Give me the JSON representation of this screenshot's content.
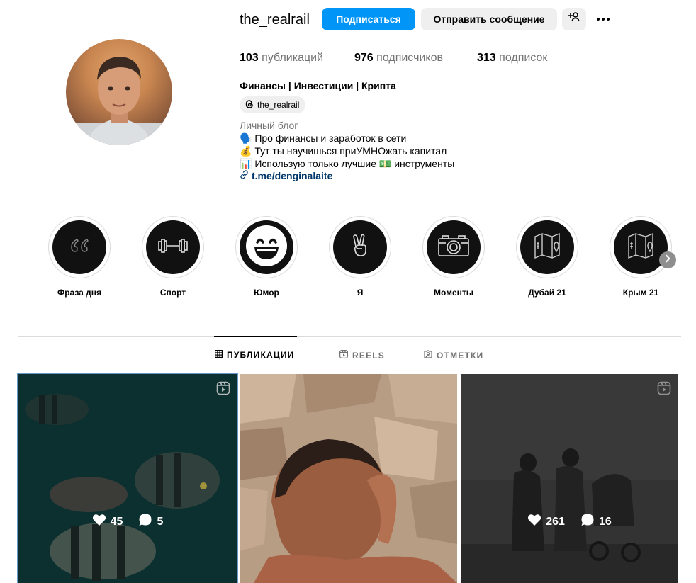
{
  "profile": {
    "username": "the_realrail",
    "follow_label": "Подписаться",
    "message_label": "Отправить сообщение",
    "stats": [
      {
        "value": "103",
        "label": "публикаций"
      },
      {
        "value": "976",
        "label": "подписчиков"
      },
      {
        "value": "313",
        "label": "подписок"
      }
    ],
    "bio_name": "Финансы | Инвестиции | Крипта",
    "threads_handle": "the_realrail",
    "category": "Личный блог",
    "bio_lines": [
      "🗣️ Про финансы и заработок в сети",
      "💰 Тут ты научишься приУМНОжать капитал",
      "📊 Использую только лучшие 💵 инструменты"
    ],
    "link": "t.me/denginalaite"
  },
  "highlights": [
    {
      "label": "Фраза дня",
      "icon": "quote-icon"
    },
    {
      "label": "Спорт",
      "icon": "dumbbell-icon"
    },
    {
      "label": "Юмор",
      "icon": "laughing-face-icon"
    },
    {
      "label": "Я",
      "icon": "peace-hand-icon"
    },
    {
      "label": "Моменты",
      "icon": "camera-icon"
    },
    {
      "label": "Дубай 21",
      "icon": "map-icon"
    },
    {
      "label": "Крым 21",
      "icon": "map-icon"
    }
  ],
  "tabs": [
    {
      "label": "ПУБЛИКАЦИИ",
      "active": true,
      "icon": "grid-icon"
    },
    {
      "label": "REELS",
      "active": false,
      "icon": "reels-icon"
    },
    {
      "label": "ОТМЕТКИ",
      "active": false,
      "icon": "tagged-icon"
    }
  ],
  "posts": [
    {
      "likes": "45",
      "comments": "5",
      "is_reel": true,
      "show_stats": true
    },
    {
      "likes": "",
      "comments": "",
      "is_reel": false,
      "show_stats": false
    },
    {
      "likes": "261",
      "comments": "16",
      "is_reel": true,
      "show_stats": true
    }
  ],
  "colors": {
    "accent": "#0095f6",
    "link": "#00376b",
    "muted": "#737373"
  }
}
